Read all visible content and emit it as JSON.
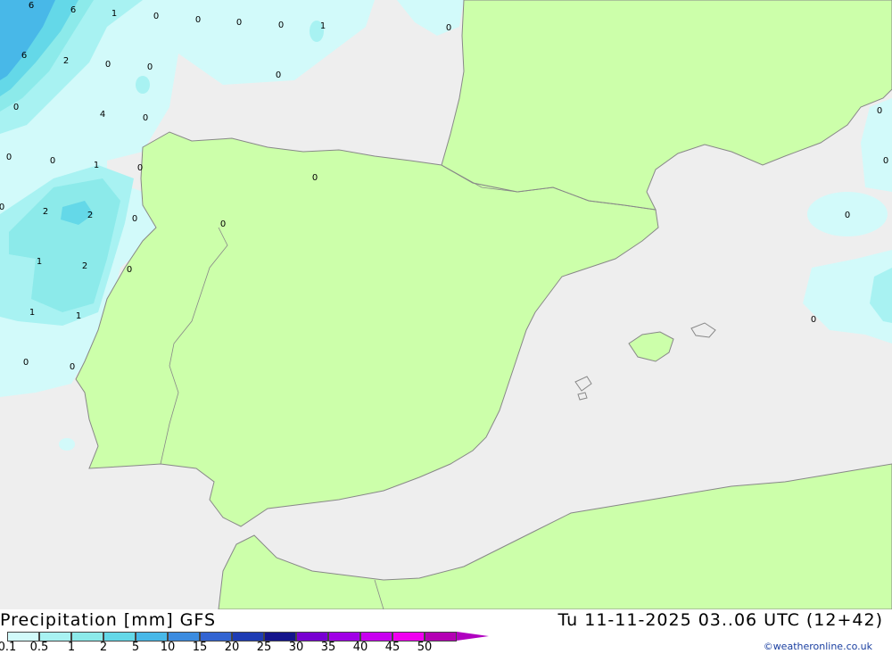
{
  "title": {
    "left": "Precipitation [mm] GFS",
    "right": "Tu 11-11-2025 03..06 UTC (12+42)"
  },
  "credit": "©weatheronline.co.uk",
  "colors": {
    "sea": "#eeeeee",
    "land": "#ccffaa",
    "coast": "#888888",
    "p01": "#d2fafa",
    "p05": "#a8f2f2",
    "p1": "#8ceaea",
    "p2": "#64d8e8",
    "p5": "#48b8e8"
  },
  "legend": {
    "colors": [
      "#d2fafa",
      "#a8f2f2",
      "#8ceaea",
      "#64d8e8",
      "#48b8e8",
      "#3c8ce0",
      "#3264d2",
      "#1e3cb4",
      "#14148c",
      "#7800d2",
      "#a000e6",
      "#c800f0",
      "#f000f0",
      "#b400b4",
      "#b000c0"
    ],
    "ticks": [
      "0.1",
      "0.5",
      "1",
      "2",
      "5",
      "10",
      "15",
      "20",
      "25",
      "30",
      "35",
      "40",
      "45",
      "50"
    ]
  },
  "contour_labels": [
    "6",
    "6",
    "1",
    "0",
    "0",
    "0",
    "0",
    "1",
    "0",
    "6",
    "2",
    "0",
    "0",
    "0",
    "4",
    "0",
    "0",
    "0",
    "0",
    "1",
    "0",
    "0",
    "2",
    "2",
    "0",
    "0",
    "1",
    "2",
    "0",
    "1",
    "1",
    "0",
    "0",
    "0",
    "0",
    "0",
    "0",
    "0"
  ]
}
